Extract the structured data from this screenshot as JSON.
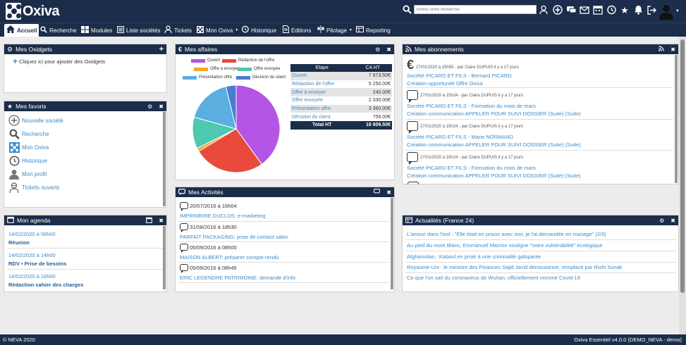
{
  "app": {
    "logo": "Oxiva"
  },
  "search": {
    "placeholder": "Entrez votre recherche"
  },
  "nav": [
    {
      "label": "Accueil",
      "icon": "home-icon"
    },
    {
      "label": "Recherche",
      "icon": "search-icon"
    },
    {
      "label": "Modules",
      "icon": "modules-icon"
    },
    {
      "label": "Liste sociétés",
      "icon": "list-icon"
    },
    {
      "label": "Tickets",
      "icon": "ticket-icon"
    },
    {
      "label": "Mon Oxiva",
      "icon": "oxiva-icon"
    },
    {
      "label": "Historique",
      "icon": "history-icon"
    },
    {
      "label": "Editions",
      "icon": "editions-icon"
    },
    {
      "label": "Pilotage",
      "icon": "pilotage-icon"
    },
    {
      "label": "Reporting",
      "icon": "reporting-icon"
    }
  ],
  "oxidgets": {
    "title": "Mes Oxidgets",
    "add_text": "Cliquez ici pour ajouter des Oxidgets"
  },
  "favoris": {
    "title": "Mes favoris",
    "items": [
      {
        "label": "Nouvelle société",
        "icon": "add-company-icon"
      },
      {
        "label": "Recherche",
        "icon": "search-icon"
      },
      {
        "label": "Mon Oxiva",
        "icon": "oxiva-icon"
      },
      {
        "label": "Historique",
        "icon": "history-icon"
      },
      {
        "label": "Mon profil",
        "icon": "profile-icon"
      },
      {
        "label": "Tickets ouverts",
        "icon": "ticket-icon"
      }
    ]
  },
  "agenda": {
    "title": "Mon agenda",
    "items": [
      {
        "date": "14/02/2020 à 08h00",
        "title": "Réunion"
      },
      {
        "date": "14/02/2020 à 14h00",
        "title": "RDV • Prise de besoins"
      },
      {
        "date": "14/02/2020 à 16h00",
        "title": "Rédaction cahier des charges"
      }
    ]
  },
  "affaires": {
    "title": "Mes affaires",
    "table_head": [
      "Etape",
      "CA HT"
    ],
    "rows": [
      {
        "label": "Ouvert",
        "value": "7 973.50€"
      },
      {
        "label": "Rédaction de l'offre",
        "value": "5 250.00€"
      },
      {
        "label": "Offre à envoyer",
        "value": "240.00€"
      },
      {
        "label": "Offre envoyée",
        "value": "2 330.00€"
      },
      {
        "label": "Présentation offre",
        "value": "3 360.00€"
      },
      {
        "label": "Décision du client",
        "value": "756.00€"
      }
    ],
    "total": {
      "label": "Total HT",
      "value": "19 909.50€"
    }
  },
  "chart_data": {
    "type": "pie",
    "categories": [
      "Ouvert",
      "Rédaction de l'offre",
      "Offre à envoyer",
      "Offre envoyée",
      "Présentation offre",
      "Décision du client"
    ],
    "values": [
      7973.5,
      5250,
      240,
      2330,
      3360,
      756
    ],
    "colors": [
      "#b455e6",
      "#e84a3c",
      "#f5a623",
      "#4ec8b0",
      "#5aaee0",
      "#4a7bd0"
    ],
    "legend_placement": "top"
  },
  "activites": {
    "title": "Mes Activités",
    "items": [
      {
        "date": "20/07/2016 à 16h04",
        "text": "IMPRIMERIE DUCLOS: e-marketing"
      },
      {
        "date": "31/08/2016 à 18h30",
        "text": "PARFAIT PACKAGING: prise de contact salon"
      },
      {
        "date": "05/09/2016 à 08h00",
        "text": "MAISON ALBERT: préparer compte-rendu"
      },
      {
        "date": "05/09/2016 à 08h45",
        "text": "ERIC LEGENDRE PATRIMOINE: demande d'info"
      }
    ]
  },
  "abonnements": {
    "title": "Mes abonnements",
    "items": [
      {
        "icon": "euro-icon",
        "meta": "27/01/2020 à 15h55 - par Claire DUPUIS il y a 17 jours",
        "line1": "Société PICARD ET FILS - Bernard PICARD",
        "line2": "Création opportunité Offre Oxiva"
      },
      {
        "icon": "comment-icon",
        "meta": "27/01/2020 à 15h24 - par Claire DUPUIS il y a 17 jours",
        "line1": "Société PICARD ET FILS - Formation du mois de mars",
        "line2": "Création communication APPELER POUR SUIVI DOSSIER (Suite) (Suite)"
      },
      {
        "icon": "comment-icon",
        "meta": "27/01/2020 à 15h24 - par Claire DUPUIS il y a 17 jours",
        "line1": "Société PICARD ET FILS - Marie NORMAND",
        "line2": "Création communication APPELER POUR SUIVI DOSSIER (Suite) (Suite)"
      },
      {
        "icon": "comment-icon",
        "meta": "27/01/2020 à 15h24 - par Claire DUPUIS il y a 17 jours",
        "line1": "Société PICARD ET FILS - Formation du mois de mars",
        "line2": "Création communication APPELER POUR SUIVI DOSSIER (Suite) (Suite)"
      }
    ]
  },
  "actualites": {
    "title": "Actualités (France 24)",
    "items": [
      "L'amour dans l'exil : \"Elle était en prison avec moi, je l'ai demandée en mariage\" (2/3)",
      "Au pied du mont Blanc, Emmanuel Macron souligne \"notre vulnérabilité\" écologique",
      "Afghanistan : Kaboul en proie à une criminalité galopante",
      "Royaume-Uni : le ministre des Finances Sajid Javid démissionne, remplacé par Rishi Sunak",
      "Ce que l'on sait du coronavirus de Wuhan, officiellement nommé Covid-19"
    ]
  },
  "footer": {
    "left": "© NEVA 2020",
    "right": "Oxiva Essentiel v4.0.0 (DEMO_NEVA - demo)"
  }
}
